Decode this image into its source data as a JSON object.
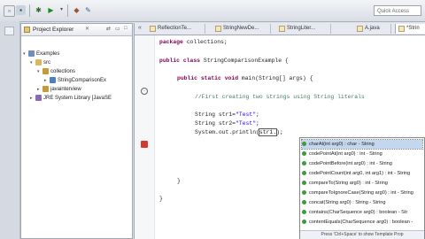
{
  "toolbar": {
    "quick_access_placeholder": "Quick Access"
  },
  "explorer": {
    "title": "Project Explorer",
    "items": [
      {
        "label": "Examples"
      },
      {
        "label": "src"
      },
      {
        "label": "collections"
      },
      {
        "label": "StringComparisonEx"
      },
      {
        "label": "javainterview"
      },
      {
        "label": "JRE System Library [JavaSE"
      }
    ]
  },
  "editor": {
    "tabs": [
      {
        "label": "ReflectionTe..."
      },
      {
        "label": "StringNewDe..."
      },
      {
        "label": "StringLiter..."
      },
      {
        "label": "A.java"
      },
      {
        "label": "*Strin"
      }
    ],
    "code_lines": {
      "l1_kw": "package",
      "l1_rest": " collections;",
      "l2_kw": "public class",
      "l2_rest": " StringComparisonExample {",
      "l3_kw": "public static void",
      "l3_rest": " main(String[] args) {",
      "l4": "//First creating two strings using String literals",
      "l5_a": "String str1=",
      "l5_s": "\"Test\"",
      "l5_b": ";",
      "l6_a": "String str2=",
      "l6_s": "\"Test\"",
      "l6_b": ";",
      "l7_a": "System.out.println(",
      "l7_b": "str1.",
      "l7_c": ");",
      "brace1": "}",
      "brace2": "}"
    }
  },
  "autocomplete": {
    "items": [
      {
        "label": "charAt(int arg0) : char - String"
      },
      {
        "label": "codePointAt(int arg0) : int - String"
      },
      {
        "label": "codePointBefore(int arg0) : int - String"
      },
      {
        "label": "codePointCount(int arg0, int arg1) : int - String"
      },
      {
        "label": "compareTo(String arg0) : int - String"
      },
      {
        "label": "compareToIgnoreCase(String arg0) : int - String"
      },
      {
        "label": "concat(String arg0) : String - String"
      },
      {
        "label": "contains(CharSequence arg0) : boolean - Str"
      },
      {
        "label": "contentEquals(CharSequence arg0) : boolean -"
      }
    ],
    "footer": "Press 'Ctrl+Space' to show Template Prop"
  }
}
